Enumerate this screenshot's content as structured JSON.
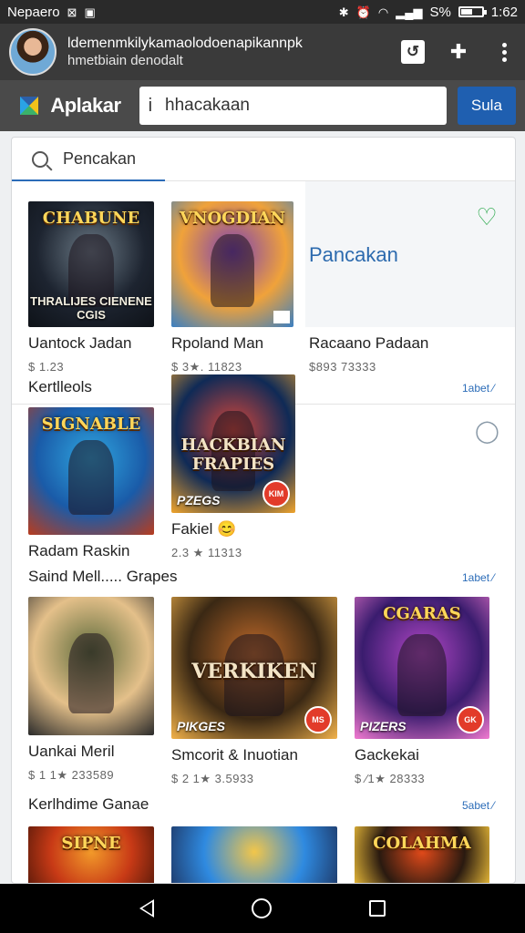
{
  "status_bar": {
    "carrier": "Nepaero",
    "time": "1:62",
    "battery_text": "S%",
    "battery_level": 0.55,
    "icons": [
      "box-icon",
      "media-icon",
      "bluetooth-icon",
      "alarm-icon",
      "wifi-icon",
      "signal-icon",
      "battery-icon"
    ]
  },
  "url_bar": {
    "line1": "ldemenmkilykamaolodoenapikannpk",
    "line2": "hmetbiain denodalt",
    "actions": [
      "tab-switch-icon",
      "gift-icon",
      "more-options-icon"
    ]
  },
  "app_bar": {
    "brand": "Aplakar",
    "search_value": "hhacakaan",
    "search_button": "Sula"
  },
  "inner_search": {
    "placeholder": "Pencakan"
  },
  "feature": {
    "title": "Pancakan"
  },
  "row1": {
    "items": [
      {
        "title_art": "CHABUNE",
        "subtitle_art": "THRALIJES CIENENE CGIS",
        "name": "Uantock Jadan",
        "price": "$ 1.23",
        "colors": [
          "#1d2430",
          "#6b7a86",
          "#0e1218"
        ]
      },
      {
        "title_art": "VNOGDIAN",
        "name": "Rpoland Man",
        "price": "$ 3★. 11823",
        "colors": [
          "#f0a23a",
          "#7a3fb5",
          "#3a7fc2"
        ]
      },
      {
        "name": "Racaano Padaan",
        "price": "$893 73333",
        "colors": []
      }
    ]
  },
  "section1": {
    "title": "Kertlleols",
    "see_all": "1abet ⁄"
  },
  "row2": {
    "items": [
      {
        "title_art": "SIGNABLE",
        "name": "Radam Raskin",
        "price": "",
        "colors": [
          "#1a5ba8",
          "#2fa6e0",
          "#b83c1e"
        ]
      },
      {
        "mid_art": "HACKBIAN FRAPIES",
        "tag": "PZEGS",
        "badge": "KIM",
        "name": "Fakiel 😊",
        "price": "2.3 ★ 11313",
        "colors": [
          "#0f2a56",
          "#d6463a",
          "#f0a42c"
        ]
      }
    ]
  },
  "section2": {
    "title": "Saind Mell..... Grapes",
    "see_all": "1abet ⁄"
  },
  "row3": {
    "items": [
      {
        "name": "Uankai Meril",
        "price": "$ 1 1★ 233589",
        "colors": [
          "#e4c08a",
          "#5c6a3a",
          "#2a2a2a"
        ]
      },
      {
        "mid_art": "VERKIKEN",
        "tag": "PIKGES",
        "badge": "MS",
        "name": "Smcorit & Inuotian",
        "price": "$ 2 1★ 3.5933",
        "colors": [
          "#3a2814",
          "#c06a2a",
          "#f2b24a"
        ]
      },
      {
        "title_art": "CGARAS",
        "tag": "PIZERS",
        "badge": "GK",
        "name": "Gackekai",
        "price": "$ ⁄1★ 28333",
        "colors": [
          "#3a1c6e",
          "#b247c6",
          "#f07ad0"
        ]
      }
    ]
  },
  "section3": {
    "title": "Kerlhdime      Ganae",
    "see_all": "5abet ⁄"
  },
  "row4": {
    "items": [
      {
        "title_art": "SIPNE",
        "colors": [
          "#c83a16",
          "#f29a2a",
          "#5a1a0a"
        ]
      },
      {
        "title_art": "",
        "colors": [
          "#2f8ae0",
          "#f2c64a",
          "#1e3a6a"
        ]
      },
      {
        "title_art": "COLAHMA",
        "colors": [
          "#2a1a10",
          "#e24a1a",
          "#f2c23a"
        ]
      }
    ]
  },
  "nav_bar": {
    "icons": [
      "back-icon",
      "home-icon",
      "recents-icon"
    ]
  }
}
